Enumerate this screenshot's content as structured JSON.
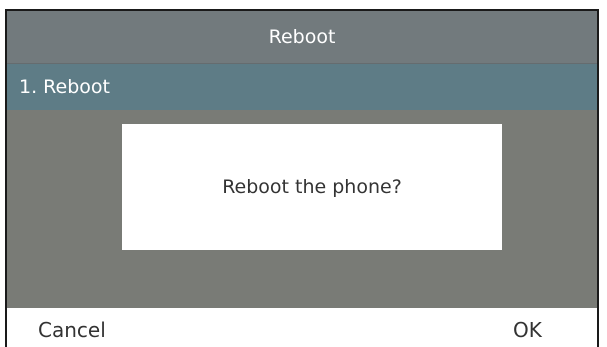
{
  "header": {
    "title": "Reboot"
  },
  "menu": {
    "items": [
      {
        "label": "1. Reboot",
        "selected": true
      }
    ]
  },
  "dialog": {
    "message": "Reboot the phone?"
  },
  "softkeys": {
    "left_label": "Cancel",
    "right_label": "OK"
  },
  "colors": {
    "title_bar": "#727a7d",
    "selected_item": "#5e7c86",
    "background": "#797b76",
    "dialog": "#ffffff",
    "text_light": "#ffffff",
    "text_dark": "#333333"
  }
}
